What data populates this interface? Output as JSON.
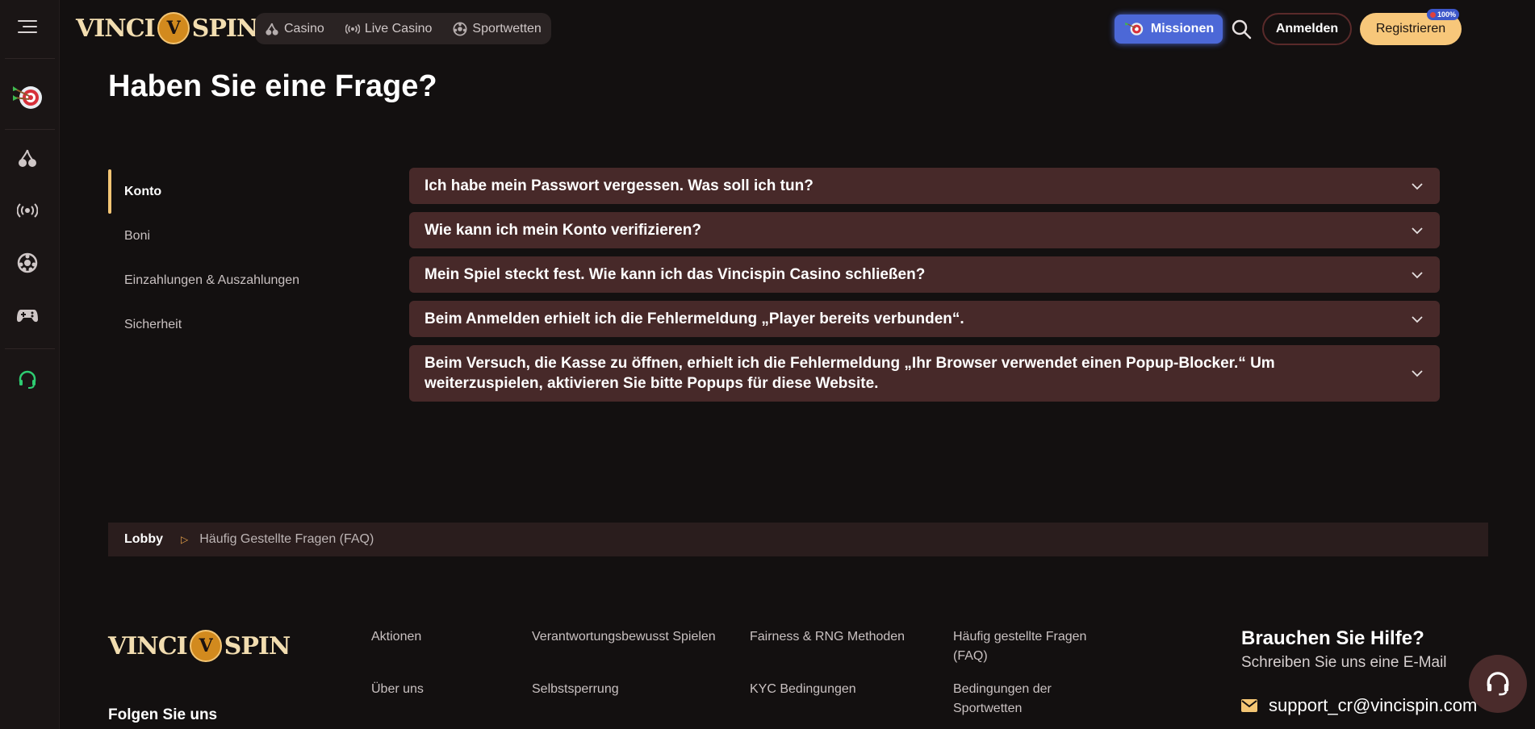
{
  "brand": {
    "logo_left": "VINCI",
    "logo_medal": "V",
    "logo_right": "SPIN"
  },
  "topnav": [
    {
      "icon": "cherry-icon",
      "label": "Casino"
    },
    {
      "icon": "broadcast-icon",
      "label": "Live Casino"
    },
    {
      "icon": "soccer-ball-icon",
      "label": "Sportwetten"
    }
  ],
  "header": {
    "missions_label": "Missionen",
    "login_label": "Anmelden",
    "register_label": "Registrieren",
    "register_badge": "100%"
  },
  "rail": [
    "menu-icon",
    "darts-target-icon",
    "cherry-icon",
    "broadcast-icon",
    "soccer-ball-icon",
    "gamepad-icon",
    "headset-icon"
  ],
  "page": {
    "title": "Haben Sie eine Frage?"
  },
  "categories": [
    {
      "label": "Konto",
      "active": true
    },
    {
      "label": "Boni",
      "active": false
    },
    {
      "label": "Einzahlungen & Auszahlungen",
      "active": false
    },
    {
      "label": "Sicherheit",
      "active": false
    }
  ],
  "faq": [
    {
      "question": "Ich habe mein Passwort vergessen. Was soll ich tun?"
    },
    {
      "question": "Wie kann ich mein Konto verifizieren?"
    },
    {
      "question": "Mein Spiel steckt fest. Wie kann ich das Vincispin Casino schließen?"
    },
    {
      "question": "Beim Anmelden erhielt ich die Fehlermeldung „Player bereits verbunden“."
    },
    {
      "question": "Beim Versuch, die Kasse zu öffnen, erhielt ich die Fehlermeldung „Ihr Browser verwendet einen Popup-Blocker.“ Um weiterzuspielen, aktivieren Sie bitte Popups für diese Website."
    }
  ],
  "breadcrumb": {
    "home": "Lobby",
    "current": "Häufig Gestellte Fragen (FAQ)"
  },
  "footer": {
    "col1": [
      "Aktionen",
      "Über uns"
    ],
    "col2": [
      "Verantwortungsbewusst Spielen",
      "Selbstsperrung"
    ],
    "col3": [
      "Fairness & RNG Methoden",
      "KYC Bedingungen"
    ],
    "col4": [
      "Häufig gestellte Fragen (FAQ)",
      "Bedingungen der Sportwetten"
    ],
    "follow": "Folgen Sie uns",
    "help_title": "Brauchen Sie Hilfe?",
    "help_subtitle": "Schreiben Sie uns eine E-Mail",
    "help_email": "support_cr@vincispin.com"
  },
  "colors": {
    "accent": "#f3c574",
    "faq_bg": "#472929",
    "missions": "#4c68d7"
  }
}
